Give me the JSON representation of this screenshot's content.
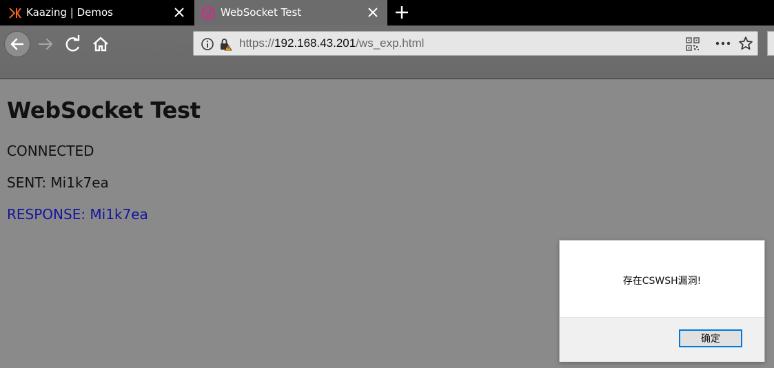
{
  "tabs": [
    {
      "title": "Kaazing | Demos",
      "icon": "kaazing-logo-icon",
      "active": false
    },
    {
      "title": "WebSocket Test",
      "icon": "smiley-favicon-icon",
      "active": true
    }
  ],
  "toolbar": {
    "url_scheme": "https://",
    "url_host": "192.168.43.201",
    "url_path": "/ws_exp.html"
  },
  "page": {
    "title": "WebSocket Test",
    "status": "CONNECTED",
    "sent": "SENT: Mi1k7ea",
    "response": "RESPONSE: Mi1k7ea"
  },
  "dialog": {
    "message": "存在CSWSH漏洞!",
    "ok_label": "确定"
  },
  "colors": {
    "response_text": "#1414a0",
    "dialog_button_border": "#0078d7",
    "favicon_pink": "#e91e8c",
    "kaazing_orange": "#f26522"
  }
}
